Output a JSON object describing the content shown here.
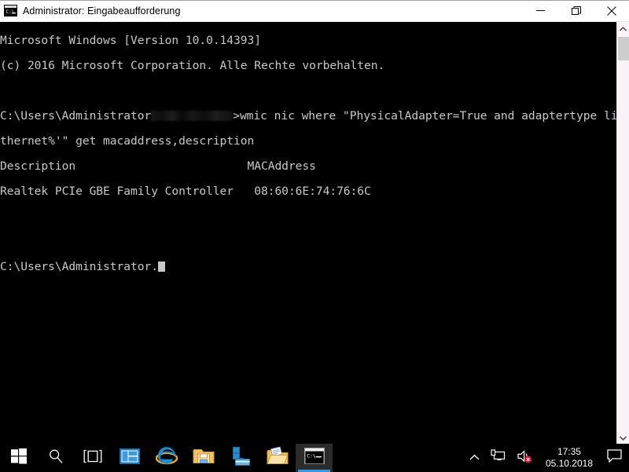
{
  "window": {
    "title": "Administrator: Eingabeaufforderung",
    "icon": "cmd-icon",
    "minimize_label": "Minimieren",
    "restore_label": "Wiederherstellen",
    "close_label": "Schließen"
  },
  "console": {
    "foreground_color": "#c8c8c8",
    "background_color": "#000000",
    "lines": [
      {
        "id": "l1",
        "text": "Microsoft Windows [Version 10.0.14393]"
      },
      {
        "id": "l2",
        "text": "(c) 2016 Microsoft Corporation. Alle Rechte vorbehalten."
      },
      {
        "id": "l3",
        "text": ""
      },
      {
        "id": "l4a",
        "text": "C:\\Users\\Administrator"
      },
      {
        "id": "l4b",
        "text": ">wmic nic where \"PhysicalAdapter=True and adaptertype like '%E"
      },
      {
        "id": "l5",
        "text": "thernet%'\" get macaddress,description"
      },
      {
        "id": "l6",
        "text": "Description                         MACAddress"
      },
      {
        "id": "l7",
        "text": "Realtek PCIe GBE Family Controller   08:60:6E:74:76:6C"
      },
      {
        "id": "l8",
        "text": ""
      },
      {
        "id": "l9",
        "text": ""
      },
      {
        "id": "l10",
        "text": "C:\\Users\\Administrator."
      }
    ],
    "command": "wmic nic where \"PhysicalAdapter=True and adaptertype like '%Ethernet%'\" get macaddress,description",
    "table": {
      "headers": [
        "Description",
        "MACAddress"
      ],
      "rows": [
        [
          "Realtek PCIe GBE Family Controller",
          "08:60:6E:74:76:6C"
        ]
      ]
    }
  },
  "scrollbar": {
    "up_arrow": "chevron-up-icon",
    "down_arrow": "chevron-down-icon",
    "thumb_label": "scroll-thumb"
  },
  "taskbar": {
    "buttons": [
      {
        "name": "start-button",
        "icon": "windows-logo-icon",
        "label": "Start",
        "active": false
      },
      {
        "name": "search-button",
        "icon": "search-icon",
        "label": "Suchen",
        "active": false
      },
      {
        "name": "task-view-button",
        "icon": "task-view-icon",
        "label": "Taskansicht",
        "active": false
      },
      {
        "name": "server-manager-button",
        "icon": "server-manager-icon",
        "label": "Server-Manager",
        "active": false
      },
      {
        "name": "internet-explorer-button",
        "icon": "internet-explorer-icon",
        "label": "Internet Explorer",
        "active": false
      },
      {
        "name": "file-explorer-button",
        "icon": "folder-icon",
        "label": "Explorer",
        "active": false
      },
      {
        "name": "toolbox-button",
        "icon": "toolbox-icon",
        "label": "Anwendung",
        "active": false
      },
      {
        "name": "files-folder-button",
        "icon": "folder-documents-icon",
        "label": "Dateien",
        "active": false
      },
      {
        "name": "command-prompt-button",
        "icon": "cmd-icon",
        "label": "Eingabeaufforderung",
        "active": true
      }
    ],
    "tray": {
      "show_hidden_icons": "chevron-up-icon",
      "network": "network-icon",
      "volume": "volume-muted-icon",
      "clock": {
        "time": "17:35",
        "date": "05.10.2018"
      },
      "action_center": "action-center-icon"
    }
  }
}
